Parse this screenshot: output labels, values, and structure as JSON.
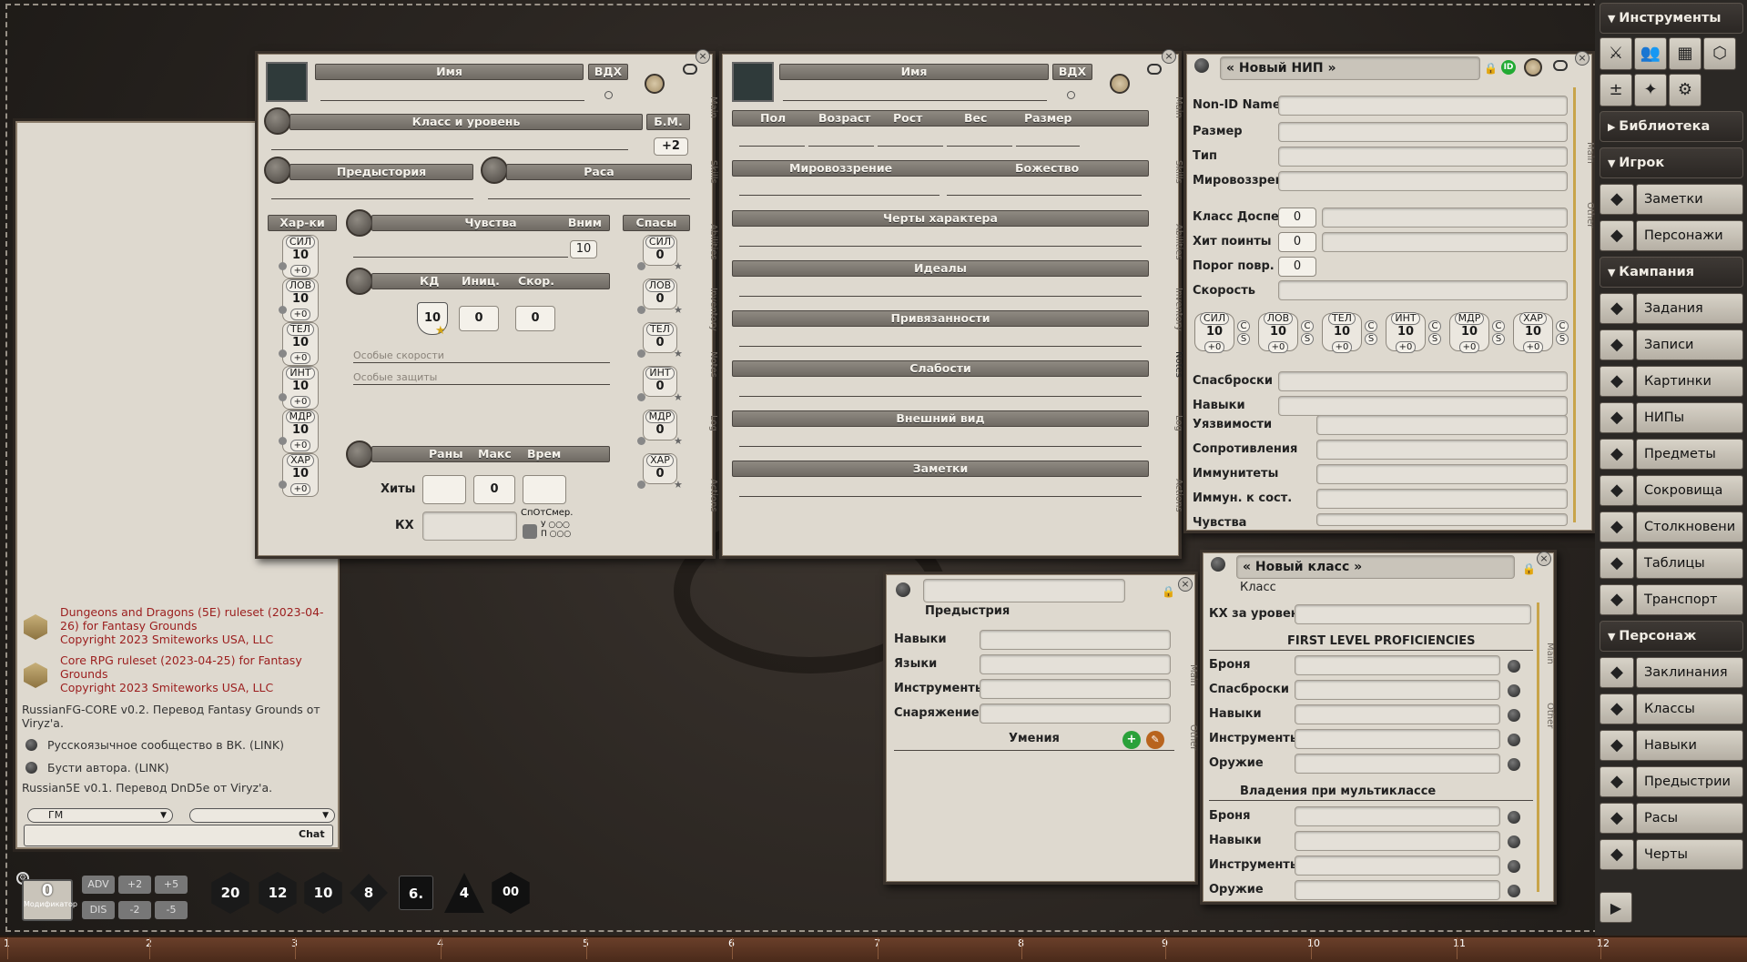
{
  "sidebar": {
    "tools_title": "Инструменты",
    "library_title": "Библиотека",
    "player_title": "Игрок",
    "player_items": [
      {
        "label": "Заметки",
        "icon": "notes-icon"
      },
      {
        "label": "Персонажи",
        "icon": "characters-icon"
      }
    ],
    "campaign_title": "Кампания",
    "campaign_items": [
      {
        "label": "Задания",
        "icon": "quests-icon"
      },
      {
        "label": "Записи",
        "icon": "story-icon"
      },
      {
        "label": "Картинки",
        "icon": "images-icon"
      },
      {
        "label": "НИПы",
        "icon": "npc-icon"
      },
      {
        "label": "Предметы",
        "icon": "items-icon"
      },
      {
        "label": "Сокровища",
        "icon": "treasure-icon"
      },
      {
        "label": "Столкновени",
        "icon": "encounters-icon"
      },
      {
        "label": "Таблицы",
        "icon": "tables-icon"
      },
      {
        "label": "Транспорт",
        "icon": "vehicles-icon"
      }
    ],
    "character_title": "Персонаж",
    "character_items": [
      {
        "label": "Заклинания",
        "icon": "spells-icon"
      },
      {
        "label": "Классы",
        "icon": "classes-icon"
      },
      {
        "label": "Навыки",
        "icon": "skills-icon"
      },
      {
        "label": "Предыстрии",
        "icon": "backgrounds-icon"
      },
      {
        "label": "Расы",
        "icon": "races-icon"
      },
      {
        "label": "Черты",
        "icon": "feats-icon"
      }
    ]
  },
  "charsheet": {
    "name_label": "Имя",
    "insp_label": "ВДХ",
    "class_label": "Класс и уровень",
    "pb_label": "Б.М.",
    "pb_value": "+2",
    "background_label": "Предыстория",
    "race_label": "Раса",
    "abilities_label": "Хар-ки",
    "senses_label": "Чувства",
    "perception_label": "Вним",
    "perception_value": "10",
    "saves_label": "Спасы",
    "ac_label": "КД",
    "init_label": "Иниц.",
    "speed_label": "Скор.",
    "ac_value": "10",
    "init_value": "0",
    "speed_value": "0",
    "special_speeds": "Особые скорости",
    "special_defenses": "Особые защиты",
    "wounds_label": "Раны",
    "max_label": "Макс",
    "temp_label": "Врем",
    "hp_label": "Хиты",
    "hp_max": "0",
    "hd_label": "КХ",
    "death_label": "СпОтСмер.",
    "death_s": "У",
    "death_f": "П",
    "abilities": [
      {
        "label": "СИЛ",
        "value": "10",
        "mod": "+0"
      },
      {
        "label": "ЛОВ",
        "value": "10",
        "mod": "+0"
      },
      {
        "label": "ТЕЛ",
        "value": "10",
        "mod": "+0"
      },
      {
        "label": "ИНТ",
        "value": "10",
        "mod": "+0"
      },
      {
        "label": "МДР",
        "value": "10",
        "mod": "+0"
      },
      {
        "label": "ХАР",
        "value": "10",
        "mod": "+0"
      }
    ],
    "saves": [
      {
        "label": "СИЛ",
        "value": "0"
      },
      {
        "label": "ЛОВ",
        "value": "0"
      },
      {
        "label": "ТЕЛ",
        "value": "0"
      },
      {
        "label": "ИНТ",
        "value": "0"
      },
      {
        "label": "МДР",
        "value": "0"
      },
      {
        "label": "ХАР",
        "value": "0"
      }
    ],
    "tabs": [
      "Main",
      "Skills",
      "Abilities",
      "Inventory",
      "Notes",
      "Log",
      "Actions"
    ]
  },
  "notes": {
    "name_label": "Имя",
    "insp_label": "ВДХ",
    "headers": [
      "Пол",
      "Возраст",
      "Рост",
      "Вес",
      "Размер"
    ],
    "alignment": "Мировоззрение",
    "deity": "Божество",
    "traits": "Черты характера",
    "ideals": "Идеалы",
    "bonds": "Привязанности",
    "flaws": "Слабости",
    "appearance": "Внешний вид",
    "notes": "Заметки"
  },
  "npc": {
    "title": "« Новый НИП »",
    "id_badge": "ID",
    "rows": [
      "Non-ID Name",
      "Размер",
      "Тип",
      "Мировоззрени"
    ],
    "ac_label": "Класс Доспеха",
    "ac_value": "0",
    "hp_label": "Хит поинты",
    "hp_value": "0",
    "threshold_label": "Порог повр.",
    "threshold_value": "0",
    "speed_label": "Скорость",
    "stats": [
      {
        "label": "СИЛ",
        "value": "10",
        "mod": "+0"
      },
      {
        "label": "ЛОВ",
        "value": "10",
        "mod": "+0"
      },
      {
        "label": "ТЕЛ",
        "value": "10",
        "mod": "+0"
      },
      {
        "label": "ИНТ",
        "value": "10",
        "mod": "+0"
      },
      {
        "label": "МДР",
        "value": "10",
        "mod": "+0"
      },
      {
        "label": "ХАР",
        "value": "10",
        "mod": "+0"
      }
    ],
    "stat_c": "С",
    "stat_s": "S",
    "rows2": [
      "Спасброски",
      "Навыки"
    ],
    "rows3": [
      "Уязвимости",
      "Сопротивления",
      "Иммунитеты",
      "Иммун. к сост.",
      "Чувства"
    ],
    "tabs": [
      "Main",
      "Other"
    ]
  },
  "background": {
    "subtitle": "Предыстрия",
    "rows": [
      "Навыки",
      "Языки",
      "Инструменты",
      "Снаряжение"
    ],
    "features": "Умения",
    "tabs": [
      "Main",
      "Other"
    ]
  },
  "class": {
    "title": "« Новый класс »",
    "subtitle": "Класс",
    "hd_label": "КХ за уровень",
    "section1": "FIRST LEVEL PROFICIENCIES",
    "rows1": [
      "Броня",
      "Спасброски",
      "Навыки",
      "Инструменты",
      "Оружие"
    ],
    "section2": "Владения при мультиклассе",
    "rows2": [
      "Броня",
      "Навыки",
      "Инструменты",
      "Оружие"
    ],
    "tabs": [
      "Main",
      "Other"
    ]
  },
  "chat": {
    "messages": [
      {
        "text": "Dungeons and Dragons (5E) ruleset (2023-04-26) for Fantasy Grounds",
        "sub": "Copyright 2023 Smiteworks USA, LLC"
      },
      {
        "text": "Core RPG ruleset (2023-04-25) for Fantasy Grounds",
        "sub": "Copyright 2023 Smiteworks USA, LLC"
      }
    ],
    "plain1": "RussianFG-CORE v0.2. Перевод Fantasy Grounds от Viryz'a.",
    "link1": "Русскоязычное сообщество в ВК. (LINK)",
    "link2": "Бусти автора. (LINK)",
    "plain2": "Russian5E v0.1. Перевод DnD5e от Viryz'a.",
    "speaker": "ГМ",
    "chat_btn": "Chat"
  },
  "modifiers": {
    "value": "0",
    "label": "Модификатор",
    "adv": "ADV",
    "dis": "DIS",
    "plus2": "+2",
    "plus5": "+5",
    "minus2": "-2",
    "minus5": "-5"
  },
  "dice": [
    "20",
    "12",
    "10",
    "8",
    "6.",
    "4",
    "00"
  ],
  "ruler": [
    "1",
    "2",
    "3",
    "4",
    "5",
    "6",
    "7",
    "8",
    "9",
    "10",
    "11",
    "12"
  ]
}
